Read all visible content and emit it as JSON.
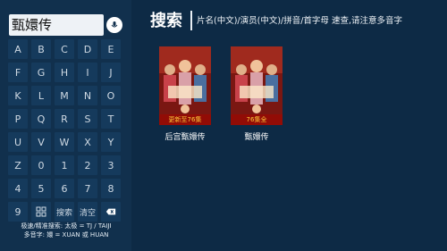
{
  "search": {
    "query": "甄嬛传",
    "title": "搜索",
    "hint": "片名(中文)/演员(中文)/拼音/首字母 速查,请注意多音字"
  },
  "keyboard": {
    "keys": [
      "A",
      "B",
      "C",
      "D",
      "E",
      "F",
      "G",
      "H",
      "I",
      "J",
      "K",
      "L",
      "M",
      "N",
      "O",
      "P",
      "Q",
      "R",
      "S",
      "T",
      "U",
      "V",
      "W",
      "X",
      "Y",
      "Z",
      "0",
      "1",
      "2",
      "3",
      "4",
      "5",
      "6",
      "7",
      "8",
      "9"
    ],
    "search_label": "搜索",
    "clear_label": "清空"
  },
  "help": {
    "line1": "极速/精准搜索: 太极 = TJ / TAIJI",
    "line2": "多音字: 嬛 = XUAN 或 HUAN"
  },
  "results": [
    {
      "title": "后宫甄嬛传",
      "badge": "更新至76集"
    },
    {
      "title": "甄嬛传",
      "badge": "76集全"
    }
  ],
  "colors": {
    "background": "#0d2a45",
    "panel": "#11304d",
    "key": "#153a5c",
    "badge_text": "#ffcb3a"
  }
}
